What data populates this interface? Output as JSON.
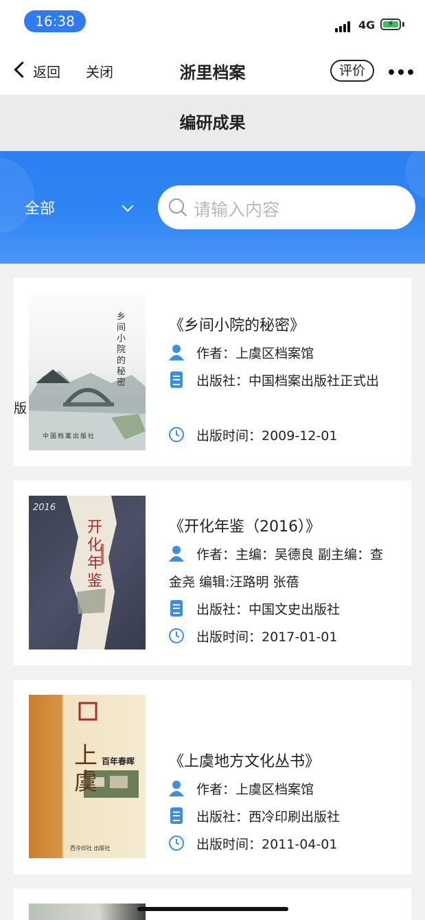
{
  "status_bar": {
    "time": "16:38",
    "network": "4G"
  },
  "nav": {
    "back_label": "返回",
    "close_label": "关闭",
    "title": "浙里档案",
    "rate_label": "评价"
  },
  "section": {
    "title": "编研成果"
  },
  "filter": {
    "category": "全部",
    "search_placeholder": "请输入内容"
  },
  "colors": {
    "accent": "#2f7bf5",
    "banner": "#2f85f4",
    "icon_blue": "#3a8ee8"
  },
  "books": [
    {
      "title": "《乡间小院的秘密》",
      "author": "作者：上虞区档案馆",
      "publisher_line1": "出版社：中国档案出版社正式出",
      "publisher_line2": "版",
      "date": "出版时间：2009-12-01",
      "cover_text": "乡间小院的秘密",
      "cover_publisher": "中国档案出版社"
    },
    {
      "title": "《开化年鉴（2016）》",
      "author_line1": "作者：主编：吴德良 副主编：查",
      "author_line2": "金尧 编辑:汪路明 张蓓",
      "publisher": "出版社：中国文史出版社",
      "date": "出版时间：2017-01-01",
      "cover_year": "2016",
      "cover_text": "开化年鉴"
    },
    {
      "title": "《上虞地方文化丛书》",
      "author": "作者：上虞区档案馆",
      "publisher": "出版社：西冷印刷出版社",
      "date": "出版时间：2011-04-01",
      "cover_text": "上虞",
      "cover_subtitle": "百年春晖",
      "cover_publisher": "西泠印社 出版社"
    }
  ]
}
